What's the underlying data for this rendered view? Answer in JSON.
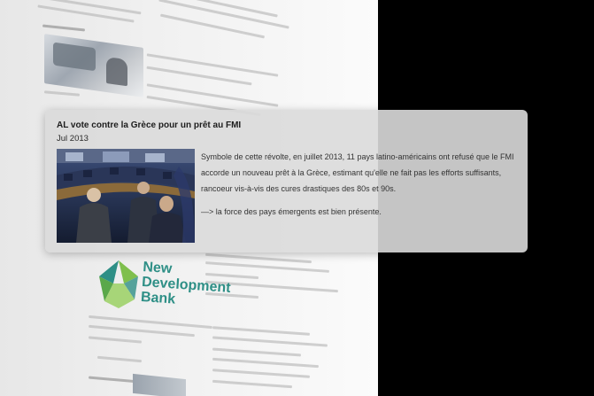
{
  "card": {
    "title": "AL vote contre la Grèce pour un prêt au FMI",
    "date": "Jul 2013",
    "body": "Symbole de cette révolte, en juillet 2013, 11 pays latino-américains ont refusé que le FMI accorde un nouveau prêt à la Grèce, estimant qu'elle ne fait pas les efforts suffisants, rancoeur vis-à-vis des cures drastiques des 80s et 90s.",
    "note": "—> la force des pays émergents est bien présente."
  },
  "background": {
    "logo_line1": "New",
    "logo_line2": "Development",
    "logo_line3": "Bank"
  }
}
